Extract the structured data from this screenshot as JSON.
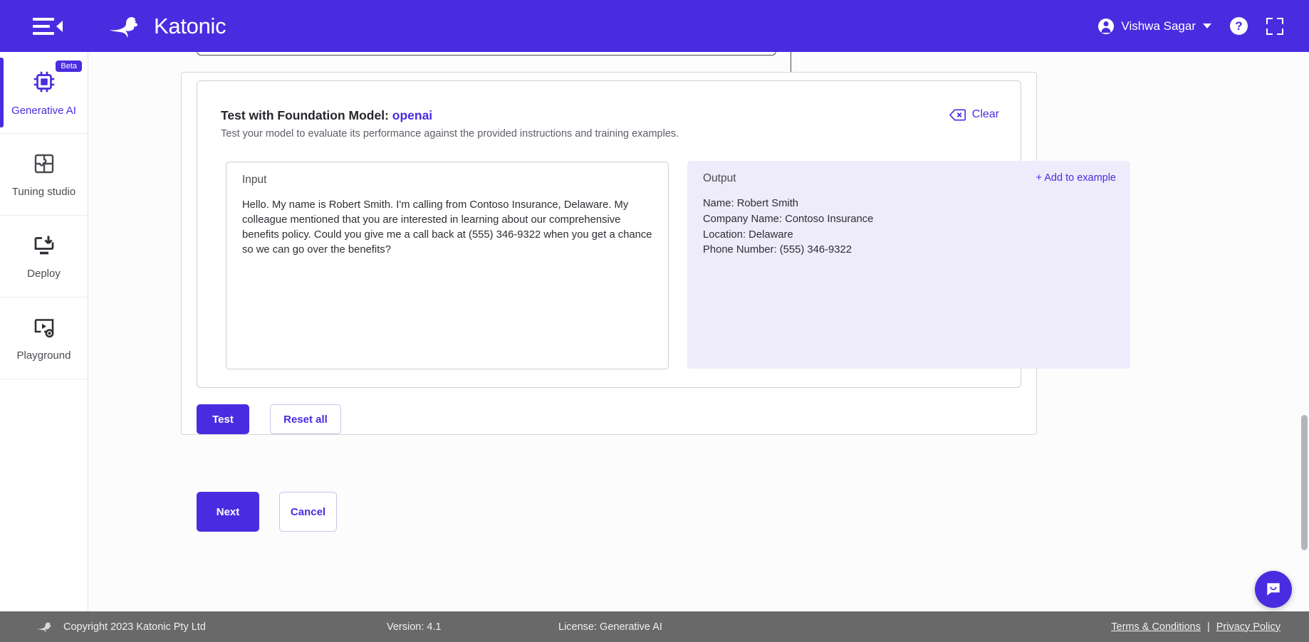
{
  "header": {
    "brand": "Katonic",
    "menu_icon": "hamburger-collapse-icon",
    "user_name": "Vishwa Sagar",
    "help_icon": "question-mark-icon",
    "fullscreen_icon": "fullscreen-expand-icon",
    "bg_color": "#4a2ce0"
  },
  "sidebar": {
    "items": [
      {
        "label": "Generative AI",
        "icon": "ai-chip-icon",
        "badge": "Beta",
        "active": true
      },
      {
        "label": "Tuning studio",
        "icon": "puzzle-piece-icon",
        "badge": "",
        "active": false
      },
      {
        "label": "Deploy",
        "icon": "monitor-download-icon",
        "badge": "",
        "active": false
      },
      {
        "label": "Playground",
        "icon": "play-gear-icon",
        "badge": "",
        "active": false
      }
    ]
  },
  "test_card": {
    "title_prefix": "Test with Foundation Model: ",
    "model": "openai",
    "subtitle": "Test your model to evaluate its performance against the provided instructions and training examples.",
    "clear_label": "Clear",
    "clear_icon": "backspace-delete-icon",
    "input": {
      "label": "Input",
      "value": "Hello. My name is Robert Smith. I'm calling from Contoso Insurance, Delaware. My colleague mentioned that you are interested in learning about our comprehensive benefits policy. Could you give me a call back at (555) 346-9322 when you get a chance so we can go over the benefits?"
    },
    "output": {
      "label": "Output",
      "add_to_example_label": "+ Add to example",
      "lines": [
        "Name: Robert Smith",
        "Company Name: Contoso Insurance",
        "Location: Delaware",
        "Phone Number: (555) 346-9322"
      ]
    },
    "test_button": "Test",
    "reset_button": "Reset all"
  },
  "wizard": {
    "next_button": "Next",
    "cancel_button": "Cancel"
  },
  "footer": {
    "copyright": "Copyright 2023 Katonic Pty Ltd",
    "version": "Version: 4.1",
    "license": "License: Generative AI",
    "terms_link": "Terms & Conditions",
    "separator": "|",
    "privacy_link": "Privacy Policy",
    "bg_color": "#696969"
  },
  "chat_widget": {
    "icon": "chat-bubble-icon"
  },
  "theme": {
    "accent": "#4a2ce0",
    "output_bg": "#eeebfb"
  }
}
